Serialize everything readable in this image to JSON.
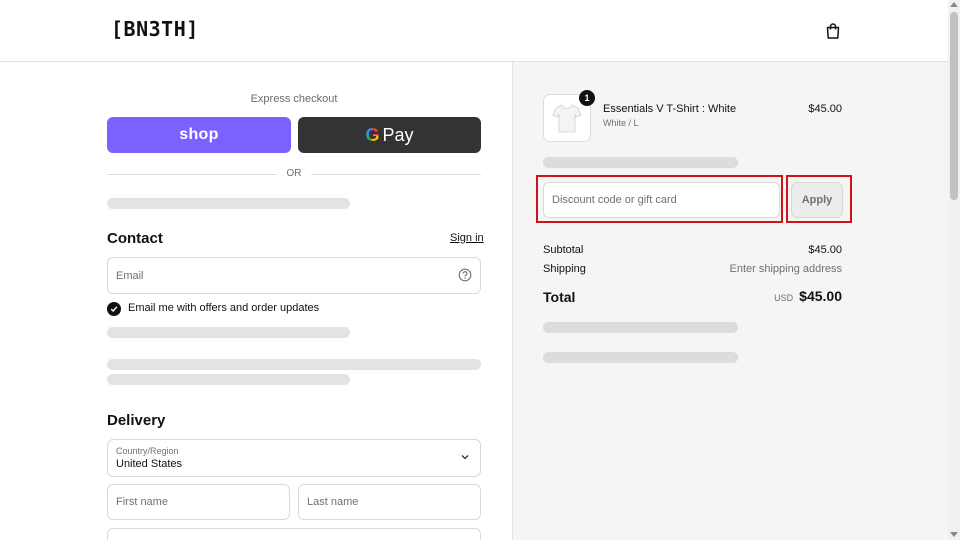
{
  "header": {
    "logo": "[BN3TH]",
    "cart_icon": "shopping-bag-icon"
  },
  "express": {
    "label": "Express checkout",
    "shop_label": "shop",
    "gpay_g": "G",
    "gpay_label": "Pay",
    "or_label": "OR"
  },
  "contact": {
    "title": "Contact",
    "signin": "Sign in",
    "email_placeholder": "Email",
    "help_icon": "question-circle-icon",
    "marketing_checked": true,
    "marketing_label": "Email me with offers and order updates"
  },
  "delivery": {
    "title": "Delivery",
    "country_label": "Country/Region",
    "country_value": "United States",
    "first_name_placeholder": "First name",
    "last_name_placeholder": "Last name"
  },
  "order": {
    "item": {
      "name": "Essentials V T-Shirt : White",
      "variant": "White / L",
      "price": "$45.00",
      "quantity": "1"
    },
    "discount_placeholder": "Discount code or gift card",
    "apply_label": "Apply",
    "subtotal_label": "Subtotal",
    "subtotal_value": "$45.00",
    "shipping_label": "Shipping",
    "shipping_value": "Enter shipping address",
    "total_label": "Total",
    "currency": "USD",
    "total_value": "$45.00"
  },
  "colors": {
    "shop_purple": "#7b61ff",
    "gpay_dark": "#333333",
    "highlight_red": "#d0121b",
    "summary_bg": "#f5f5f5"
  }
}
